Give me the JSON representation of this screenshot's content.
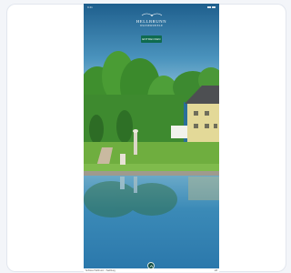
{
  "status_bar": {
    "time": "9:41",
    "battery": "100%"
  },
  "brand": {
    "title": "HELLBRUNN",
    "subtitle": "WASSERSPIELE"
  },
  "cta": {
    "label": "ENTDECKEN"
  },
  "footer": {
    "left_text": "Schloss Hellbrunn – Salzburg",
    "right_text": "1/8"
  },
  "colors": {
    "sky": "#2a6f9a",
    "cta": "#0f6b4f",
    "nav": "#0f4b3f",
    "facade": "#e3d998",
    "water": "#5aa0c4"
  },
  "icons": {
    "ornament": "ornament-icon",
    "nav": "chevron-up-icon"
  }
}
